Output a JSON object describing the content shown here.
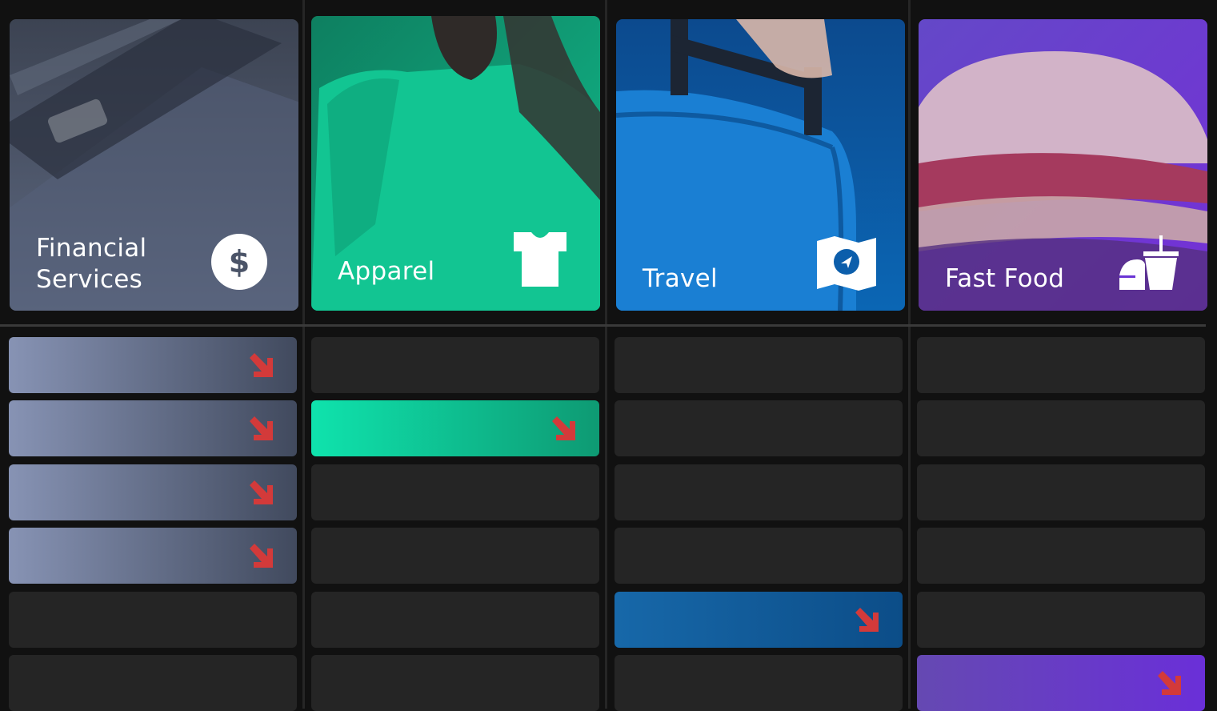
{
  "categories": [
    {
      "id": "financial",
      "label": "Financial\nServices",
      "icon": "dollar-circle-icon",
      "gradient": [
        "#3f4657",
        "#5f6b86"
      ],
      "row_gradient": [
        "#8793b4",
        "#414a5e"
      ],
      "active_rows": [
        0,
        1,
        2,
        3
      ]
    },
    {
      "id": "apparel",
      "label": "Apparel",
      "icon": "t-shirt-icon",
      "gradient": [
        "#0f8f6f",
        "#13c996"
      ],
      "row_gradient": [
        "#0fe3ad",
        "#0e9a73"
      ],
      "active_rows": [
        1
      ]
    },
    {
      "id": "travel",
      "label": "Travel",
      "icon": "map-location-icon",
      "gradient": [
        "#0c4a9a",
        "#1d86dc"
      ],
      "row_gradient": [
        "#1768a9",
        "#0c4d88"
      ],
      "active_rows": [
        4
      ]
    },
    {
      "id": "fast-food",
      "label": "Fast Food",
      "icon": "burger-drink-icon",
      "gradient": [
        "#6b45c9",
        "#7a32d8"
      ],
      "row_gradient": [
        "#6549b2",
        "#6a2fd8"
      ],
      "active_rows": [
        5
      ]
    }
  ],
  "row_count": 6,
  "arrow_icon": "arrow-down-right-icon",
  "arrow_color": "#d33a3a",
  "empty_row_color": "#252525"
}
